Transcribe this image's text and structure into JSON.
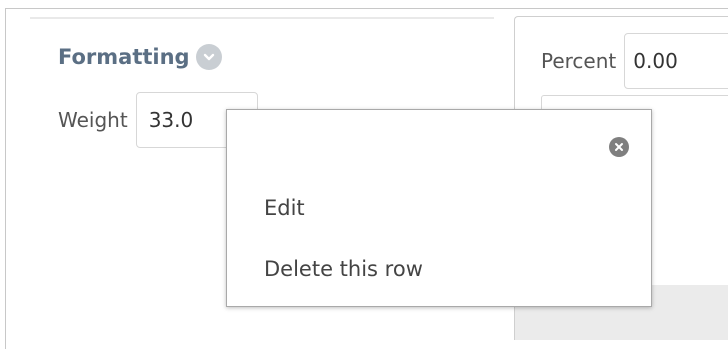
{
  "formatting": {
    "title": "Formatting",
    "weight_label": "Weight",
    "weight_value": "33.0"
  },
  "right": {
    "percent_label": "Percent",
    "percent_value": "0.00"
  },
  "context_menu": {
    "items": [
      {
        "label": "Edit"
      },
      {
        "label": "Delete this row"
      }
    ]
  },
  "icons": {
    "section_toggle": "chevron-down-icon",
    "close": "close-icon"
  }
}
